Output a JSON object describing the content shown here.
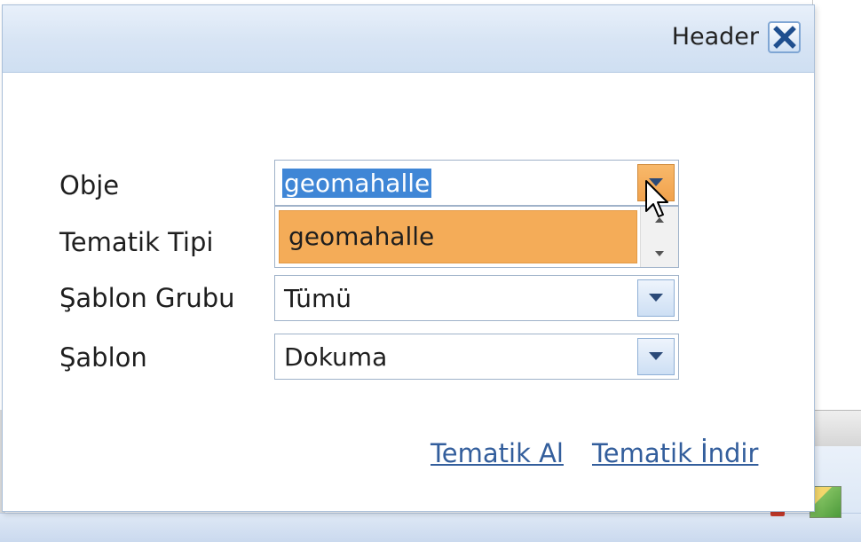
{
  "dialog": {
    "title": "Header",
    "close_icon": "close-x-icon"
  },
  "form": {
    "fields": [
      {
        "label": "Obje",
        "value": "geomahalle",
        "state": "open-selected"
      },
      {
        "label": "Tematik Tipi",
        "value": ""
      },
      {
        "label": "Şablon Grubu",
        "value": "Tümü"
      },
      {
        "label": "Şablon",
        "value": "Dokuma"
      }
    ],
    "dropdown_options": [
      "geomahalle"
    ]
  },
  "actions": {
    "get_thematic": "Tematik Al",
    "download_thematic": "Tematik İndir"
  },
  "colors": {
    "header_bg": "#d7e4f4",
    "dropdown_hover": "#f4ac58",
    "selection": "#3f86d6",
    "link": "#335e9c"
  }
}
